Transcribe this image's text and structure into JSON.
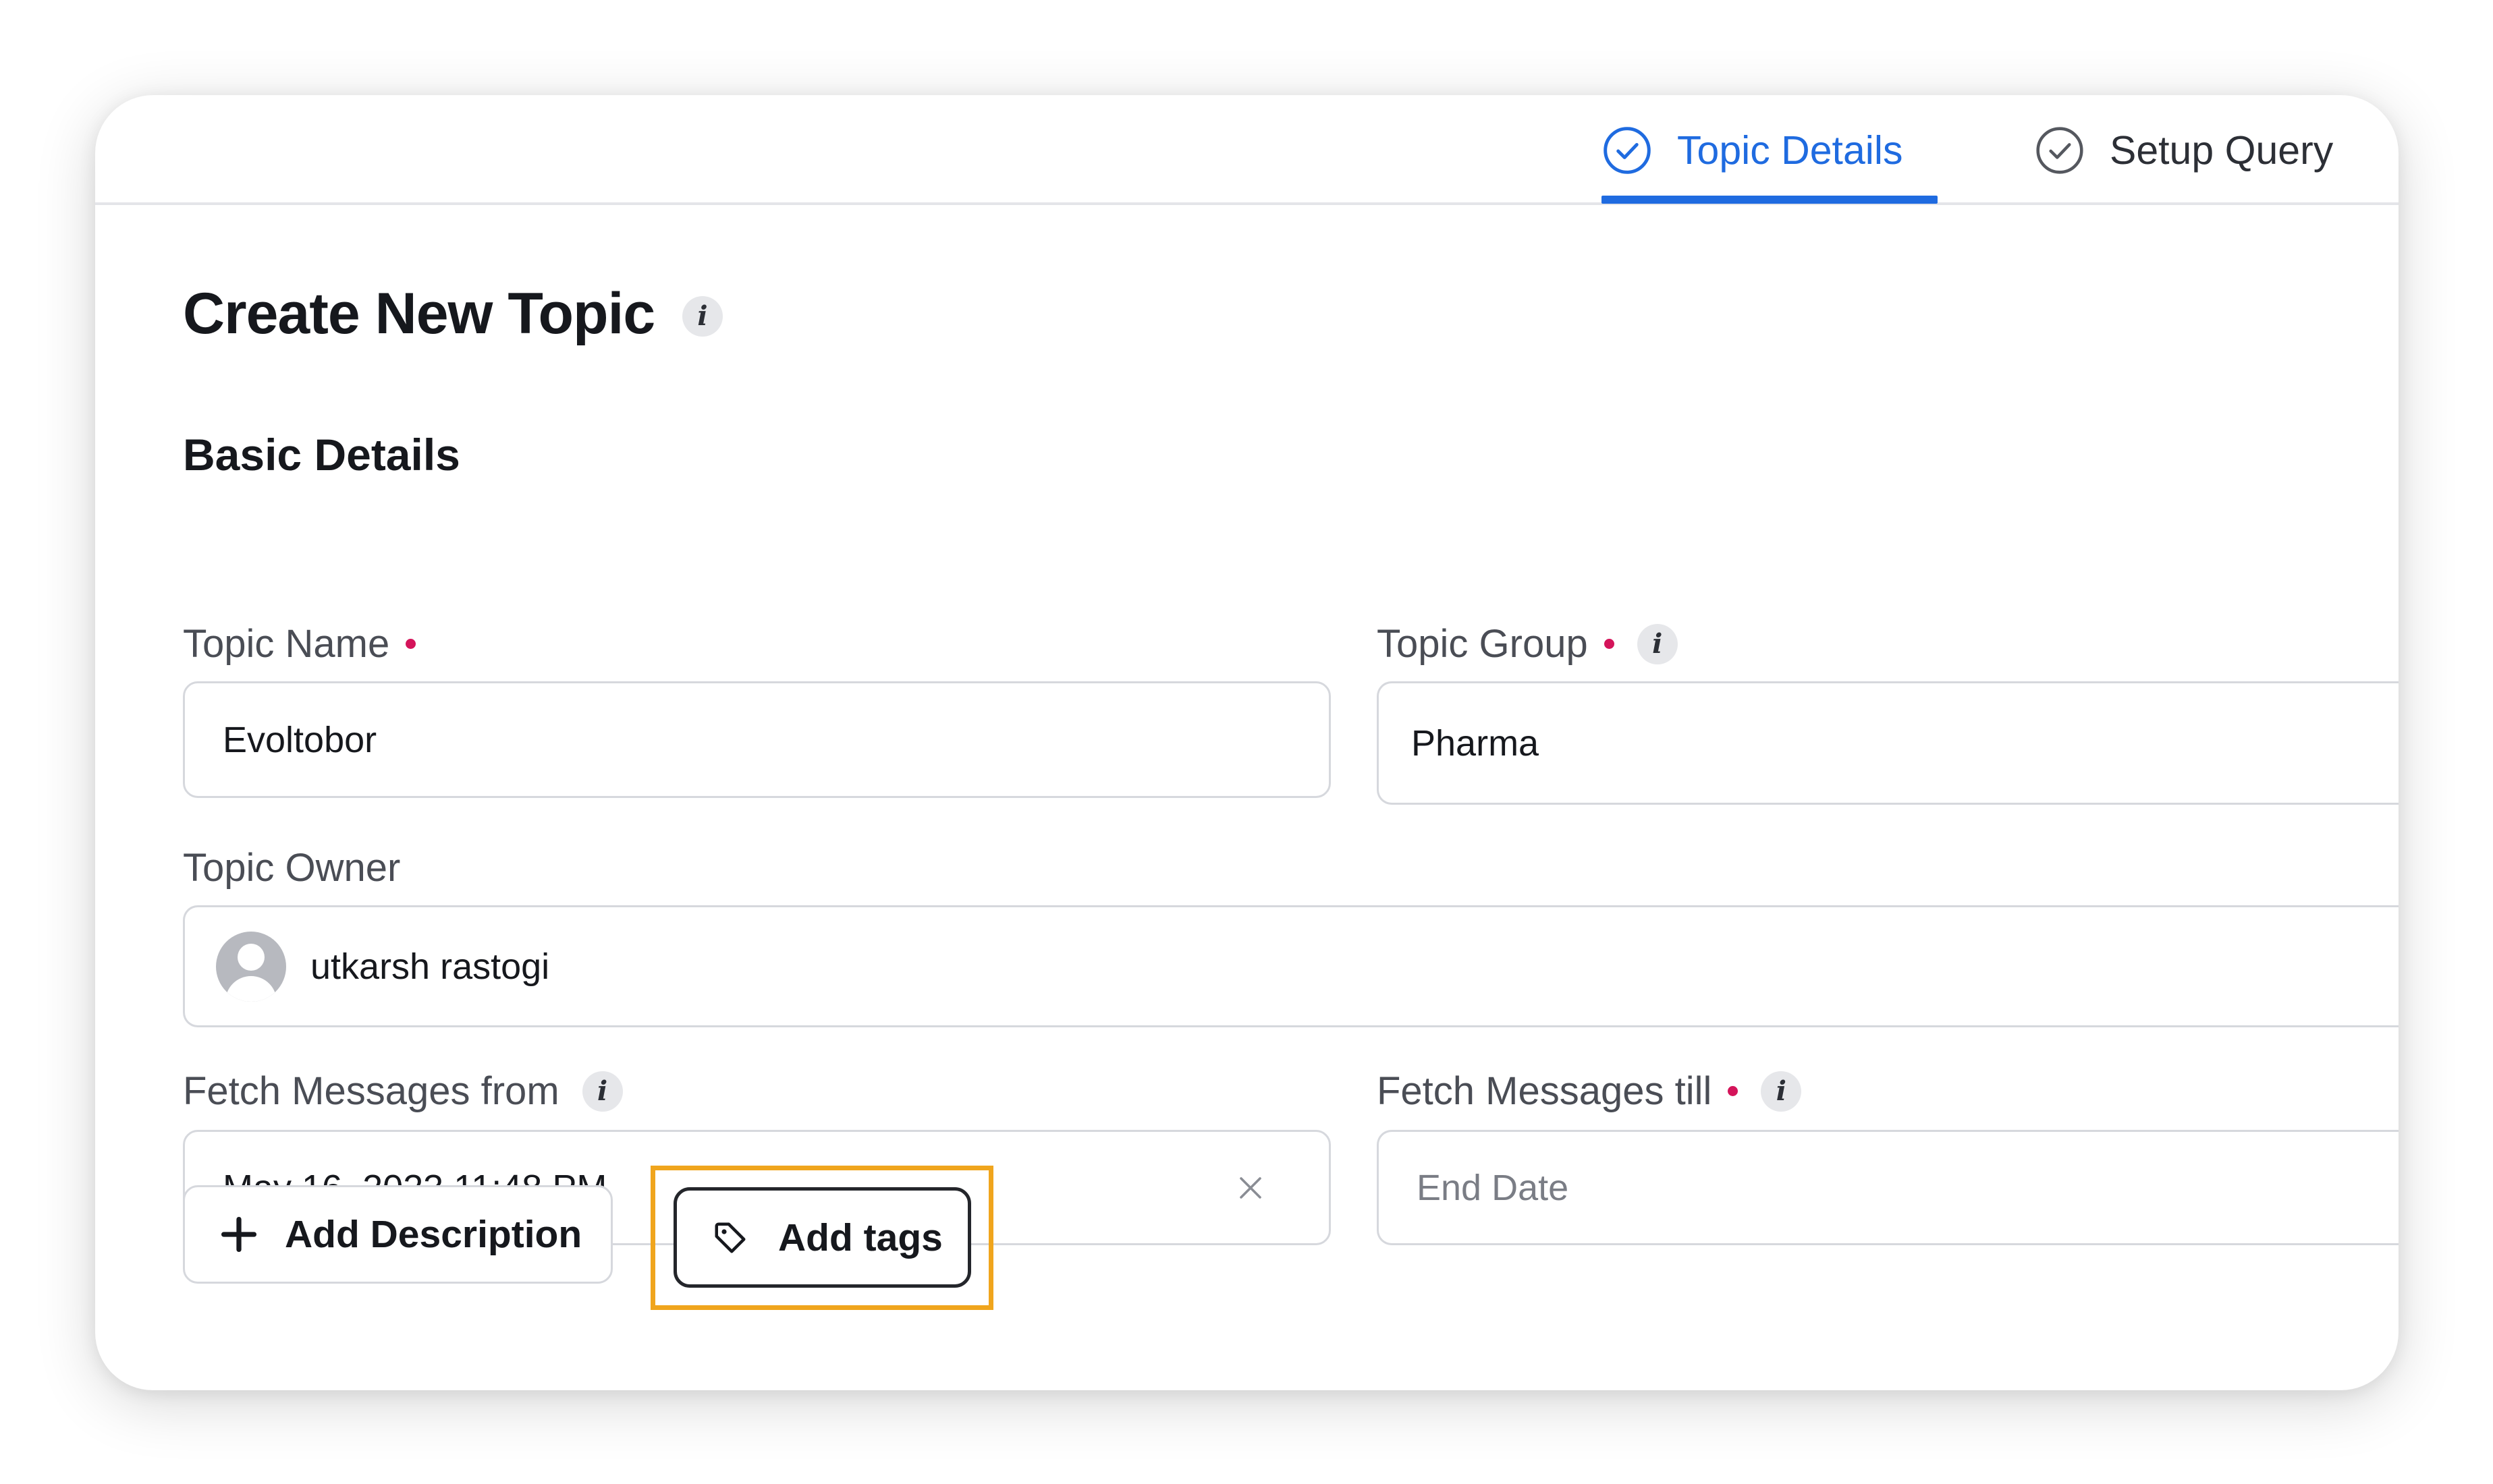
{
  "tabs": [
    {
      "label": "Topic Details",
      "state": "active",
      "icon": "check-circle-icon"
    },
    {
      "label": "Setup Query",
      "state": "inactive",
      "icon": "check-circle-icon"
    }
  ],
  "page": {
    "title": "Create New Topic",
    "section_title": "Basic Details"
  },
  "fields": {
    "topic_name": {
      "label": "Topic Name",
      "value": "Evoltobor",
      "required": true
    },
    "topic_group": {
      "label": "Topic Group",
      "value": "Pharma",
      "required": true
    },
    "topic_owner": {
      "label": "Topic Owner",
      "value": "utkarsh rastogi"
    },
    "fetch_from": {
      "label": "Fetch Messages from",
      "value": "May 16, 2023 11:48 PM"
    },
    "fetch_till": {
      "label": "Fetch Messages till",
      "placeholder": "End Date",
      "required": true
    }
  },
  "buttons": {
    "add_description": "Add Description",
    "add_tags": "Add tags"
  },
  "colors": {
    "accent": "#1f6be0",
    "required_dot": "#d4145a",
    "highlight": "#f0a51d",
    "info_badge": "#e6e7ea"
  },
  "icons": {
    "info": "i"
  }
}
